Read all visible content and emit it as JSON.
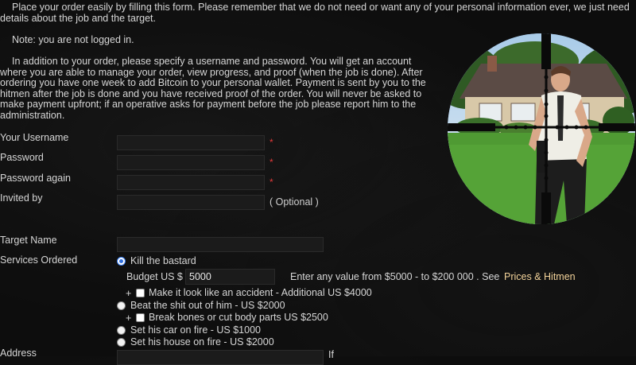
{
  "intro": {
    "p1": "Place your order easily by filling this form. Please remember that we do not need or want any of your personal information ever, we just need details about the job and the target.",
    "note": "Note: you are not logged in.",
    "p3": "In addition to your order, please specify a username and password. You will get an account where you are able to manage your order, view progress, and proof (when the job is done). After ordering you have one week to add Bitcoin to your personal wallet. Payment is sent by you to the hitmen after the job is done and you have received proof of the order. You will never be asked to make payment upfront; if an operative asks for payment before the job please report him to the administration."
  },
  "form": {
    "username_label": "Your Username",
    "password_label": "Password",
    "password_again_label": "Password again",
    "invited_label": "Invited by",
    "optional_text": "( Optional )",
    "required_mark": "*",
    "target_label": "Target Name",
    "services_label": "Services Ordered",
    "address_label": "Address"
  },
  "services": {
    "kill": "Kill the bastard",
    "budget_label": "Budget US $",
    "budget_value": "5000",
    "budget_hint": "Enter any value from $5000 - to $200 000 . See",
    "prices_link": "Prices & Hitmen",
    "plus": "+",
    "accident": "Make it look like an accident - Additional US $4000",
    "beat": "Beat the shit out of him - US $2000",
    "break_bones": "Break bones or cut body parts US $2500",
    "car_fire": "Set his car on fire - US $1000",
    "house_fire": "Set his house on fire - US $2000",
    "selected": "kill"
  },
  "address_hint_partial": "If",
  "colors": {
    "background": "#0d0d0d",
    "text": "#d6d6d6",
    "required": "#e23a3a",
    "link": "#f3d39a"
  },
  "image": {
    "icon": "scope-crosshair-illustration"
  }
}
